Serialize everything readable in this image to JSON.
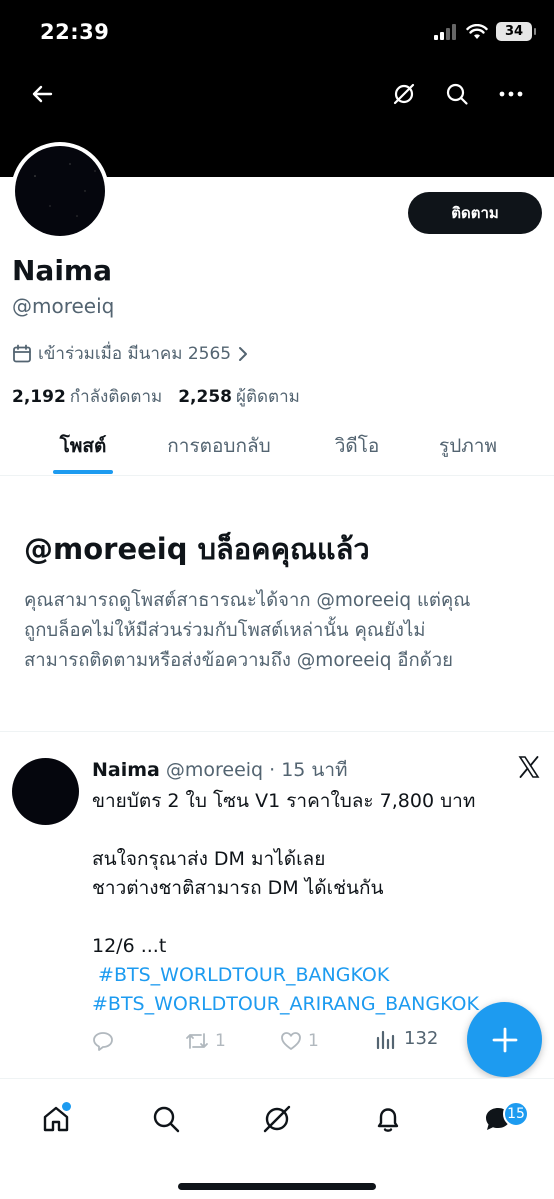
{
  "status_bar": {
    "time": "22:39",
    "battery": "34"
  },
  "profile": {
    "name": "Naima",
    "handle": "@moreeiq",
    "joined": "เข้าร่วมเมื่อ มีนาคม 2565",
    "following_count": "2,192",
    "following_label": "กำลังติดตาม",
    "followers_count": "2,258",
    "followers_label": "ผู้ติดตาม",
    "follow_button": "ติดตาม"
  },
  "tabs": [
    {
      "label": "โพสต์",
      "active": true
    },
    {
      "label": "การตอบกลับ",
      "active": false
    },
    {
      "label": "วิดีโอ",
      "active": false
    },
    {
      "label": "รูปภาพ",
      "active": false
    }
  ],
  "blocked": {
    "title": "@moreeiq บล็อคคุณแล้ว",
    "lines": [
      "คุณสามารถดูโพสต์สาธารณะได้จาก @moreeiq แต่คุณ",
      "ถูกบล็อคไม่ให้มีส่วนร่วมกับโพสต์เหล่านั้น คุณยังไม่",
      "สามารถติดตามหรือส่งข้อความถึง @moreeiq อีกด้วย"
    ]
  },
  "tweet": {
    "name": "Naima",
    "handle": "@moreeiq",
    "time": "· 15 นาที",
    "lines": [
      "ขายบัตร 2 ใบ โซน V1 ราคาใบละ 7,800 บาท",
      "",
      "สนใจกรุณาส่ง DM มาได้เลย",
      "ชาวต่างชาติสามารถ DM ได้เช่นกัน",
      "",
      "12/6 ...t"
    ],
    "hashtags": [
      " #BTS_WORLDTOUR_BANGKOK",
      "#BTS_WORLDTOUR_ARIRANG_BANGKOK"
    ],
    "retweets": "1",
    "likes": "1",
    "views": "132"
  },
  "bottom_nav": {
    "messages_badge": "15"
  },
  "colors": {
    "accent": "#1d9bf0",
    "text": "#0f1419",
    "muted": "#536471"
  }
}
